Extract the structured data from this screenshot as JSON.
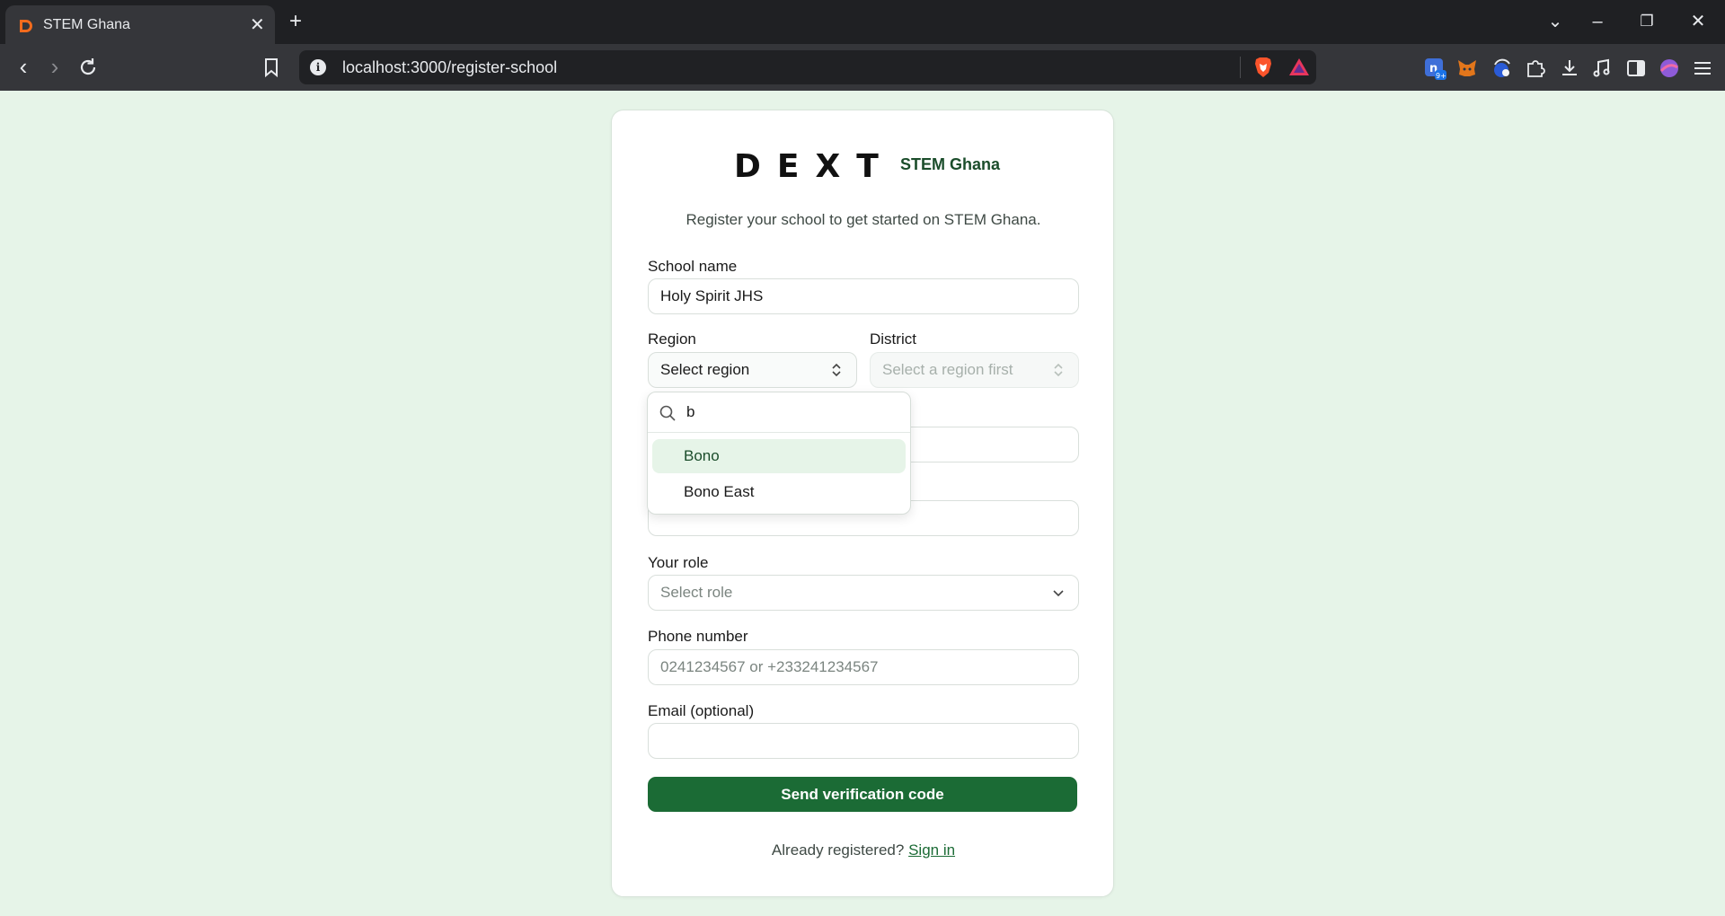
{
  "browser": {
    "tab_title": "STEM Ghana",
    "url": "localhost:3000/register-school"
  },
  "brand": {
    "logo": "DEXT",
    "subtitle": "STEM Ghana",
    "intro": "Register your school to get started on STEM Ghana."
  },
  "form": {
    "school_name": {
      "label": "School name",
      "value": "Holy Spirit JHS"
    },
    "region": {
      "label": "Region",
      "value": "Select region"
    },
    "district": {
      "label": "District",
      "placeholder": "Select a region first"
    },
    "role": {
      "label": "Your role",
      "placeholder": "Select role"
    },
    "phone": {
      "label": "Phone number",
      "placeholder": "0241234567 or +233241234567"
    },
    "email": {
      "label": "Email (optional)",
      "value": ""
    },
    "submit_label": "Send verification code"
  },
  "footer": {
    "prompt": "Already registered?",
    "link": "Sign in"
  },
  "region_dropdown": {
    "search_value": "b",
    "options": [
      {
        "label": "Bono",
        "highlighted": true
      },
      {
        "label": "Bono East",
        "highlighted": false
      }
    ]
  },
  "colors": {
    "page_bg": "#e6f4e8",
    "accent": "#1b6b35",
    "brand_text": "#1b4d2b"
  }
}
